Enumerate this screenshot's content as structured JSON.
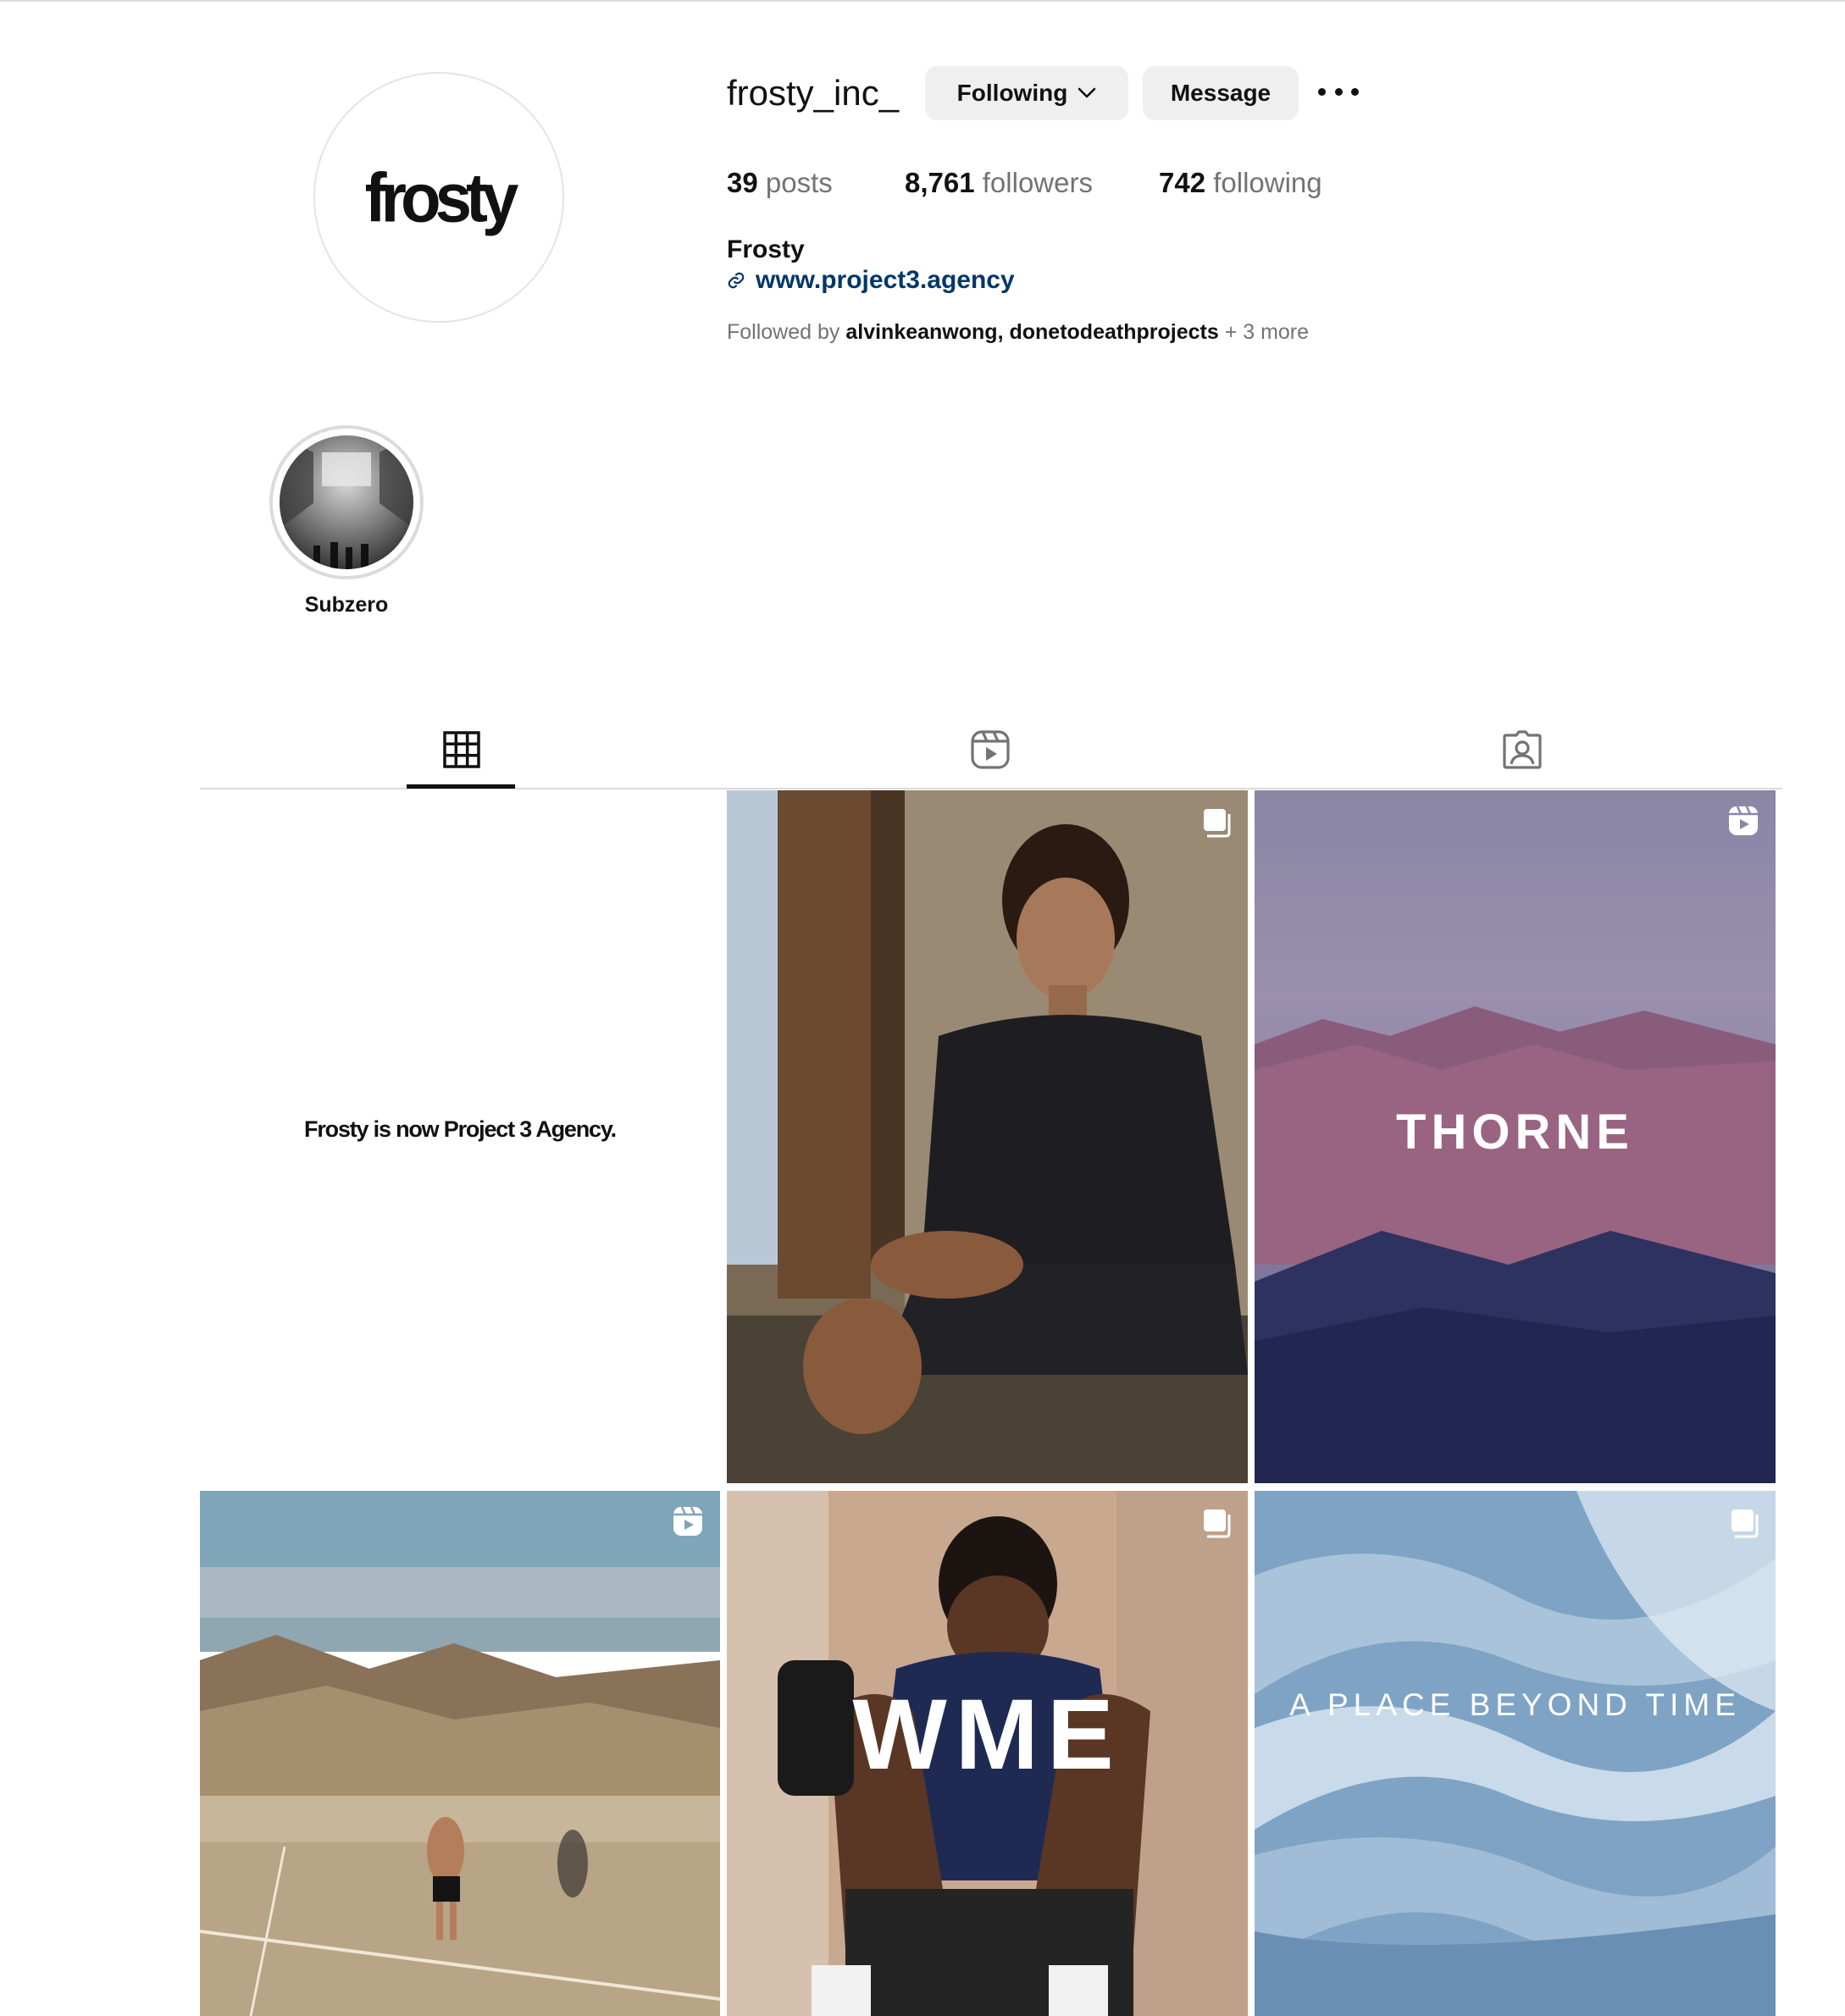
{
  "profile": {
    "avatar_logo_text": "frosty",
    "username": "frosty_inc_",
    "following_label": "Following",
    "message_label": "Message",
    "posts_count": "39",
    "posts_label": "posts",
    "followers_count": "8,761",
    "followers_label": "followers",
    "following_count": "742",
    "following_count_label": "following",
    "full_name": "Frosty",
    "website": "www.project3.agency",
    "followed_by_prefix": "Followed by",
    "followed_by_user1": "alvinkeanwong",
    "followed_by_sep": ",",
    "followed_by_user2": "donetodeathprojects",
    "followed_by_more": "+ 3 more"
  },
  "highlights": [
    {
      "label": "Subzero"
    }
  ],
  "tabs": [
    {
      "icon": "grid-icon",
      "active": true
    },
    {
      "icon": "reels-icon",
      "active": false
    },
    {
      "icon": "tagged-icon",
      "active": false
    }
  ],
  "posts": [
    {
      "text": "Frosty is now Project 3 Agency.",
      "badge": ""
    },
    {
      "text": "",
      "badge": "carousel-icon"
    },
    {
      "text": "THORNE",
      "badge": "reel-icon"
    },
    {
      "text": "",
      "badge": "reel-icon"
    },
    {
      "text": "WME",
      "badge": "carousel-icon"
    },
    {
      "text": "A PLACE BEYOND TIME",
      "badge": "carousel-icon"
    }
  ],
  "colors": {
    "link": "#00376b",
    "muted": "#737373",
    "button_bg": "#efefef"
  }
}
